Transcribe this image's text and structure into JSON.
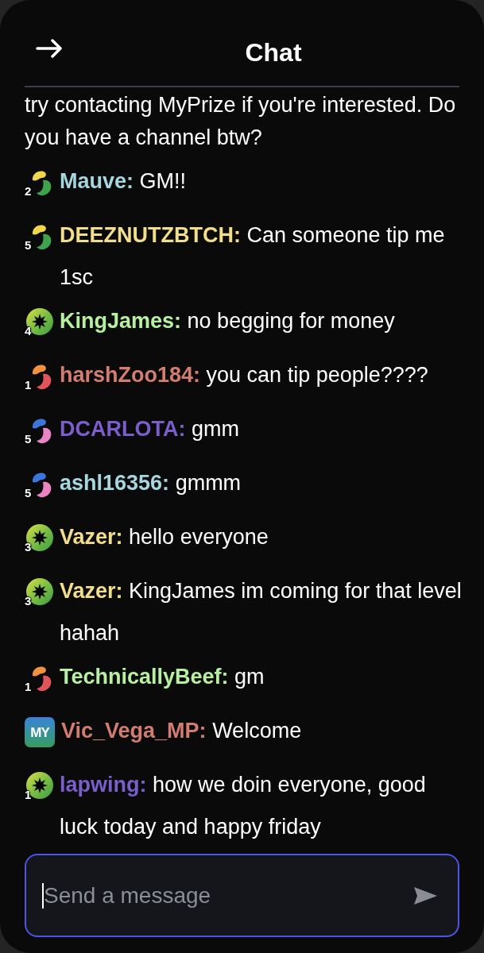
{
  "header": {
    "title": "Chat"
  },
  "messages": [
    {
      "kind": "text",
      "text": "try contacting MyPrize if you're interested. Do you have a channel btw?"
    },
    {
      "kind": "user",
      "badge": {
        "kind": "gold",
        "level": "2"
      },
      "user": "Mauve:",
      "color": "#a6d6de",
      "text": "GM!!"
    },
    {
      "kind": "user",
      "badge": {
        "kind": "gold",
        "level": "5"
      },
      "user": "DEEZNUTZBTCH:",
      "color": "#f2dd8c",
      "text": "Can someone tip me 1sc"
    },
    {
      "kind": "user",
      "badge": {
        "kind": "star",
        "level": "4"
      },
      "user": "KingJames:",
      "color": "#b8f0a2",
      "text": "no begging for money"
    },
    {
      "kind": "user",
      "badge": {
        "kind": "ember",
        "level": "1"
      },
      "user": "harshZoo184:",
      "color": "#d27d70",
      "text": "you can tip people????"
    },
    {
      "kind": "user",
      "badge": {
        "kind": "azure",
        "level": "5"
      },
      "user": "DCARLOTA:",
      "color": "#7b5dcb",
      "text": "gmm"
    },
    {
      "kind": "user",
      "badge": {
        "kind": "azure",
        "level": "5"
      },
      "user": "ashl16356:",
      "color": "#a6d6de",
      "text": "gmmm"
    },
    {
      "kind": "user",
      "badge": {
        "kind": "star",
        "level": "3"
      },
      "user": "Vazer:",
      "color": "#f2dd8c",
      "text": "hello everyone"
    },
    {
      "kind": "user",
      "badge": {
        "kind": "star",
        "level": "3"
      },
      "user": "Vazer:",
      "color": "#f2dd8c",
      "text": "KingJames im coming for that level hahah"
    },
    {
      "kind": "user",
      "badge": {
        "kind": "ember",
        "level": "1"
      },
      "user": "TechnicallyBeef:",
      "color": "#b8f0a2",
      "text": "gm"
    },
    {
      "kind": "user",
      "badge": {
        "kind": "logo",
        "label": "MY"
      },
      "user": "Vic_Vega_MP:",
      "color": "#d27d70",
      "text": "Welcome"
    },
    {
      "kind": "user",
      "badge": {
        "kind": "star",
        "level": "1"
      },
      "user": "lapwing:",
      "color": "#7b5dcb",
      "text": "how we doin everyone, good luck today and happy friday"
    }
  ],
  "composer": {
    "placeholder": "Send a message",
    "focused": true
  }
}
